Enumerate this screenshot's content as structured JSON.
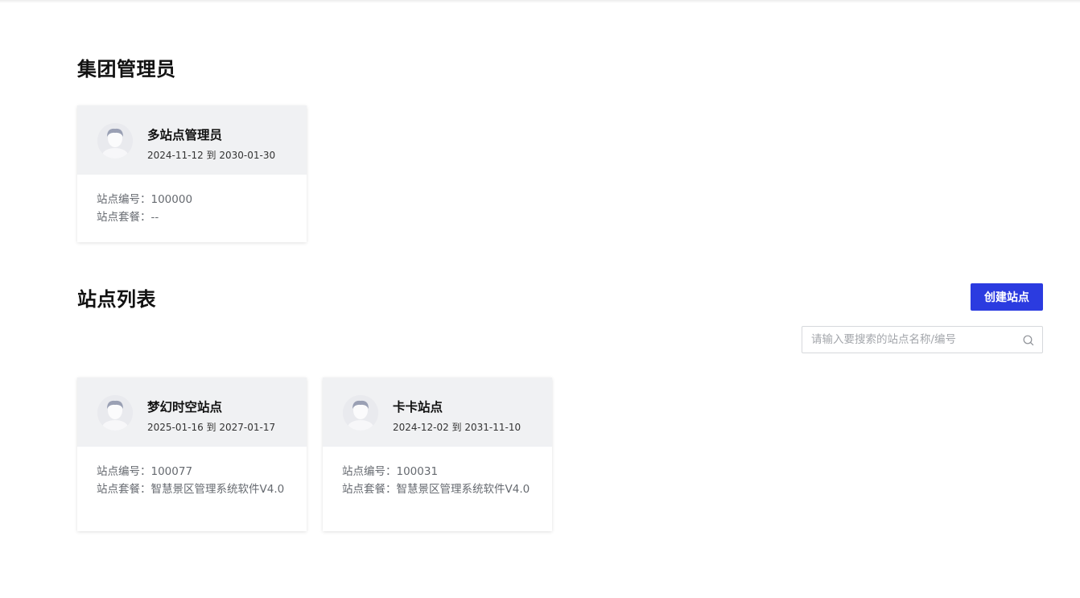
{
  "admin_section": {
    "title": "集团管理员",
    "card": {
      "name": "多站点管理员",
      "dates": "2024-11-12 到 2030-01-30",
      "site_id": "站点编号：100000",
      "site_package": "站点套餐：--"
    }
  },
  "sites_section": {
    "title": "站点列表",
    "create_button": "创建站点",
    "search_placeholder": "请输入要搜索的站点名称/编号",
    "cards": [
      {
        "name": "梦幻时空站点",
        "dates": "2025-01-16 到 2027-01-17",
        "site_id": "站点编号：100077",
        "site_package": "站点套餐：智慧景区管理系统软件V4.0"
      },
      {
        "name": "卡卡站点",
        "dates": "2024-12-02 到 2031-11-10",
        "site_id": "站点编号：100031",
        "site_package": "站点套餐：智慧景区管理系统软件V4.0"
      }
    ]
  },
  "colors": {
    "accent": "#2b3be0",
    "card_header_bg": "#f0f1f3"
  }
}
